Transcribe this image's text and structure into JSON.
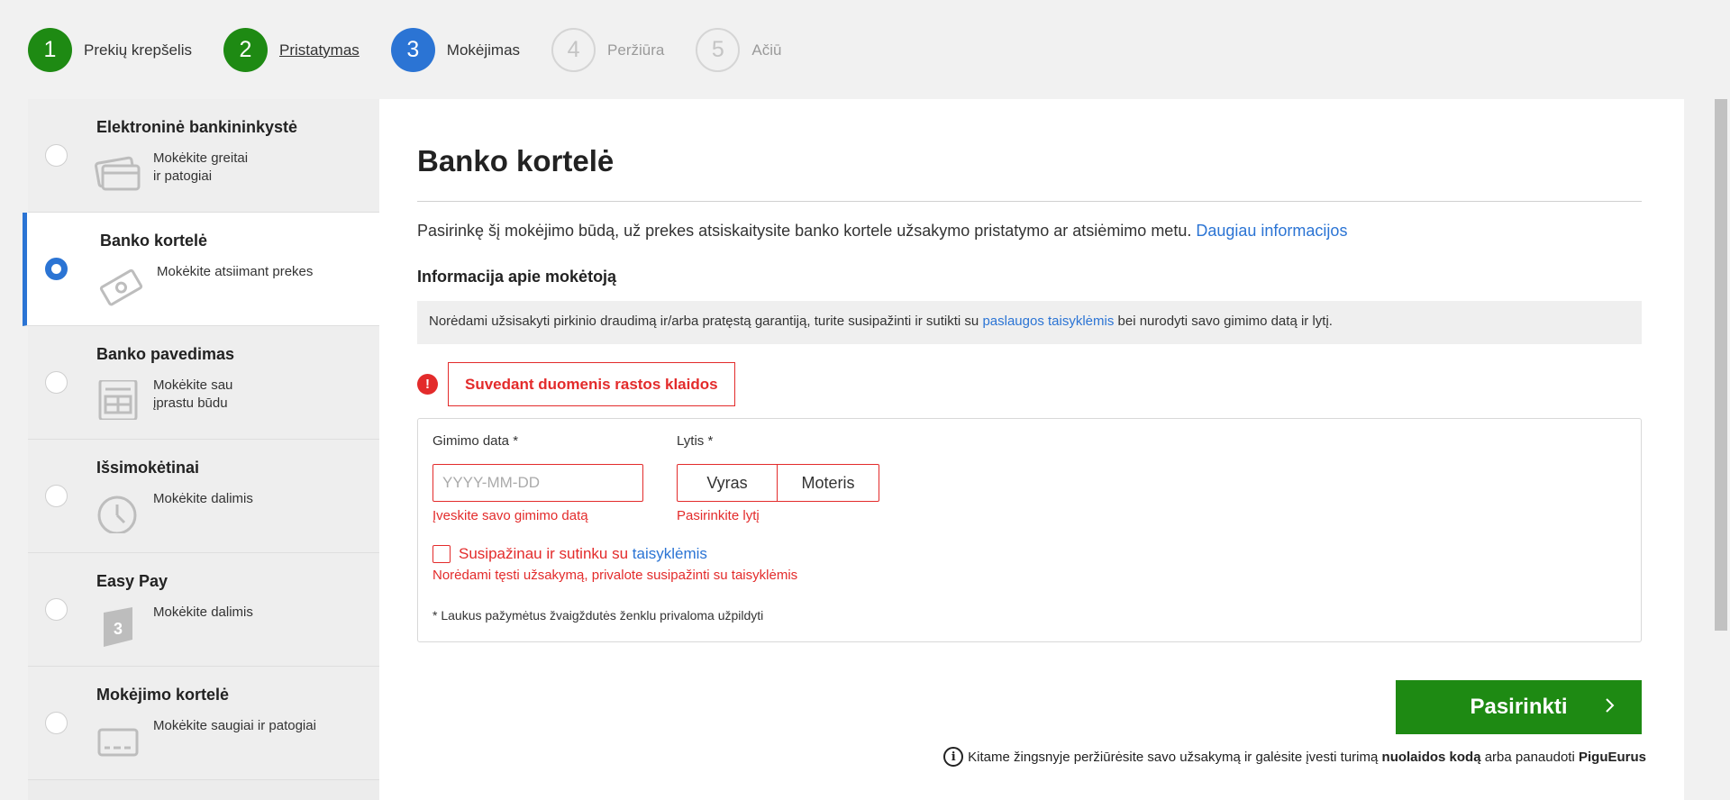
{
  "stepper": {
    "steps": [
      {
        "num": "1",
        "label": "Prekių krepšelis",
        "state": "done"
      },
      {
        "num": "2",
        "label": "Pristatymas",
        "state": "done"
      },
      {
        "num": "3",
        "label": "Mokėjimas",
        "state": "active"
      },
      {
        "num": "4",
        "label": "Peržiūra",
        "state": "todo"
      },
      {
        "num": "5",
        "label": "Ačiū",
        "state": "todo"
      }
    ]
  },
  "methods": [
    {
      "title": "Elektroninė bankininkystė",
      "desc_line1": "Mokėkite greitai",
      "desc_line2": "ir patogiai",
      "icon": "cards-icon",
      "selected": false
    },
    {
      "title": "Banko kortelė",
      "desc_line1": "Mokėkite atsiimant prekes",
      "desc_line2": "",
      "icon": "cash-icon",
      "selected": true
    },
    {
      "title": "Banko pavedimas",
      "desc_line1": "Mokėkite sau",
      "desc_line2": "įprastu būdu",
      "icon": "invoice-icon",
      "selected": false
    },
    {
      "title": "Išsimokėtinai",
      "desc_line1": "Mokėkite dalimis",
      "desc_line2": "",
      "icon": "clock-icon",
      "selected": false
    },
    {
      "title": "Easy Pay",
      "desc_line1": "Mokėkite dalimis",
      "desc_line2": "",
      "icon": "easypay-3-icon",
      "selected": false
    },
    {
      "title": "Mokėjimo kortelė",
      "desc_line1": "Mokėkite saugiai ir patogiai",
      "desc_line2": "",
      "icon": "payment-card-icon",
      "selected": false
    }
  ],
  "panel": {
    "title": "Banko kortelė",
    "intro": "Pasirinkę šį mokėjimo būdą, už prekes atsiskaitysite banko kortele užsakymo pristatymo ar atsiėmimo metu.",
    "more_link": "Daugiau informacijos",
    "payer_title": "Informacija apie mokėtoją",
    "notice_before": "Norėdami užsisakyti pirkinio draudimą ir/arba pratęstą garantiją, turite susipažinti ir sutikti su",
    "notice_link": "paslaugos taisyklėmis",
    "notice_after": "bei nurodyti savo gimimo datą ir lytį.",
    "error_icon": "!",
    "error_message": "Suvedant duomenis rastos klaidos"
  },
  "form": {
    "birth_label": "Gimimo data *",
    "birth_placeholder": "YYYY-MM-DD",
    "birth_error": "Įveskite savo gimimo datą",
    "gender_label": "Lytis *",
    "gender_male": "Vyras",
    "gender_female": "Moteris",
    "gender_error": "Pasirinkite lytį",
    "terms_text": "Susipažinau ir sutinku su",
    "terms_link": "taisyklėmis",
    "terms_error": "Norėdami tęsti užsakymą, privalote susipažinti su taisyklėmis",
    "required_note": "* Laukus pažymėtus žvaigždutės ženklu privaloma užpildyti"
  },
  "action": {
    "select_label": "Pasirinkti",
    "hint_icon": "i",
    "hint_before": "Kitame žingsnyje peržiūrėsite savo užsakymą ir galėsite įvesti turimą",
    "hint_bold1": "nuolaidos kodą",
    "hint_middle": "arba panaudoti",
    "hint_bold2": "PiguEurus"
  },
  "colors": {
    "green": "#1e8a13",
    "blue": "#2b74d4",
    "error": "#e32b2b"
  }
}
